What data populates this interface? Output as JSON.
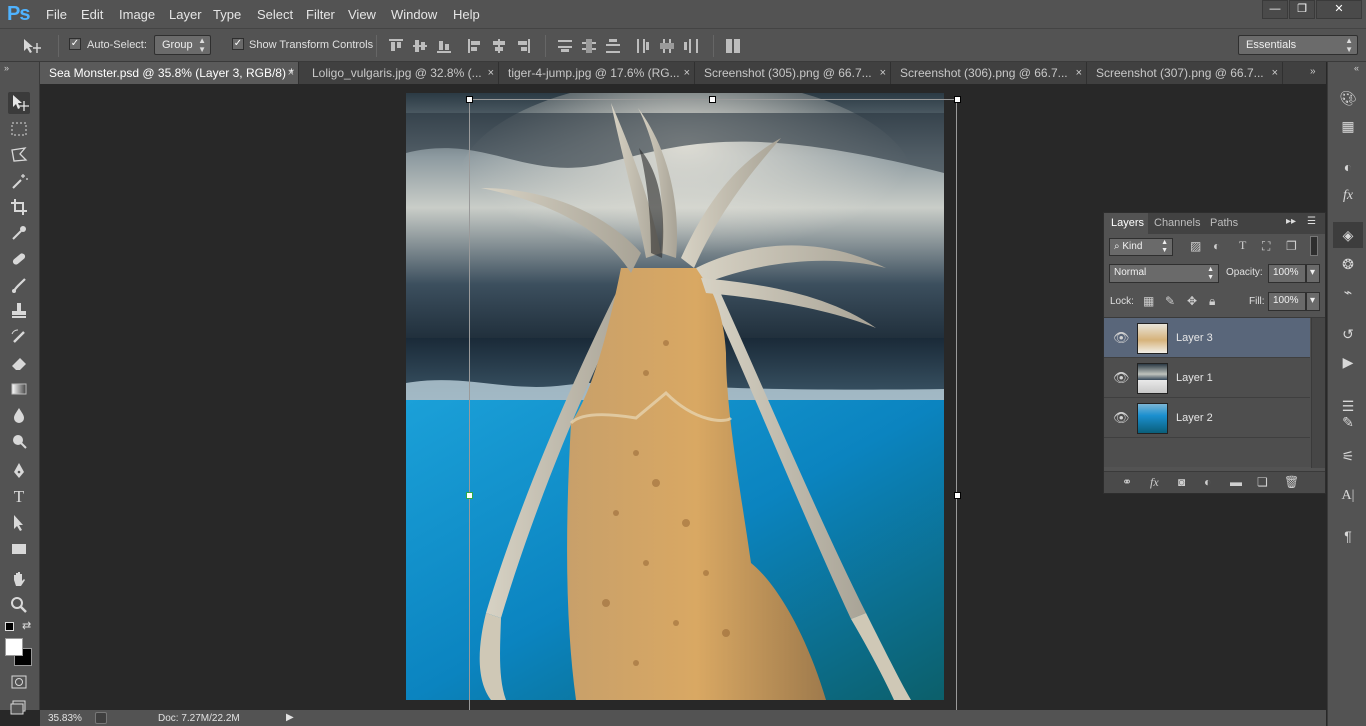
{
  "app": {
    "logo": "Ps"
  },
  "menu": [
    "File",
    "Edit",
    "Image",
    "Layer",
    "Type",
    "Select",
    "Filter",
    "View",
    "Window",
    "Help"
  ],
  "window_controls": {
    "minimize": "—",
    "restore": "❐",
    "close": "✕"
  },
  "options": {
    "auto_select_label": "Auto-Select:",
    "auto_select_checked": true,
    "group_value": "Group",
    "transform_controls_label": "Show Transform Controls",
    "transform_controls_checked": true,
    "workspace": "Essentials"
  },
  "tabs": [
    {
      "label": "Sea Monster.psd @ 35.8% (Layer 3, RGB/8) *",
      "active": true
    },
    {
      "label": "Loligo_vulgaris.jpg @ 32.8% (...",
      "active": false
    },
    {
      "label": "tiger-4-jump.jpg @ 17.6% (RG...",
      "active": false
    },
    {
      "label": "Screenshot (305).png @ 66.7...",
      "active": false
    },
    {
      "label": "Screenshot (306).png @ 66.7...",
      "active": false
    },
    {
      "label": "Screenshot (307).png @ 66.7...",
      "active": false
    }
  ],
  "tab_close": "×",
  "status": {
    "zoom": "35.83%",
    "doc": "Doc: 7.27M/22.2M",
    "arrow": "▶"
  },
  "layers_panel": {
    "tabs": [
      "Layers",
      "Channels",
      "Paths"
    ],
    "filter_kind": "Kind",
    "blend_mode": "Normal",
    "opacity_label": "Opacity:",
    "opacity_value": "100%",
    "lock_label": "Lock:",
    "fill_label": "Fill:",
    "fill_value": "100%",
    "layers": [
      {
        "name": "Layer 3",
        "selected": true
      },
      {
        "name": "Layer 1",
        "selected": false
      },
      {
        "name": "Layer 2",
        "selected": false
      }
    ]
  },
  "colors": {
    "accent_blue": "#4fb3ff",
    "selected_layer": "#59667a",
    "panel_bg": "#535353",
    "canvas_bg": "#282828"
  }
}
